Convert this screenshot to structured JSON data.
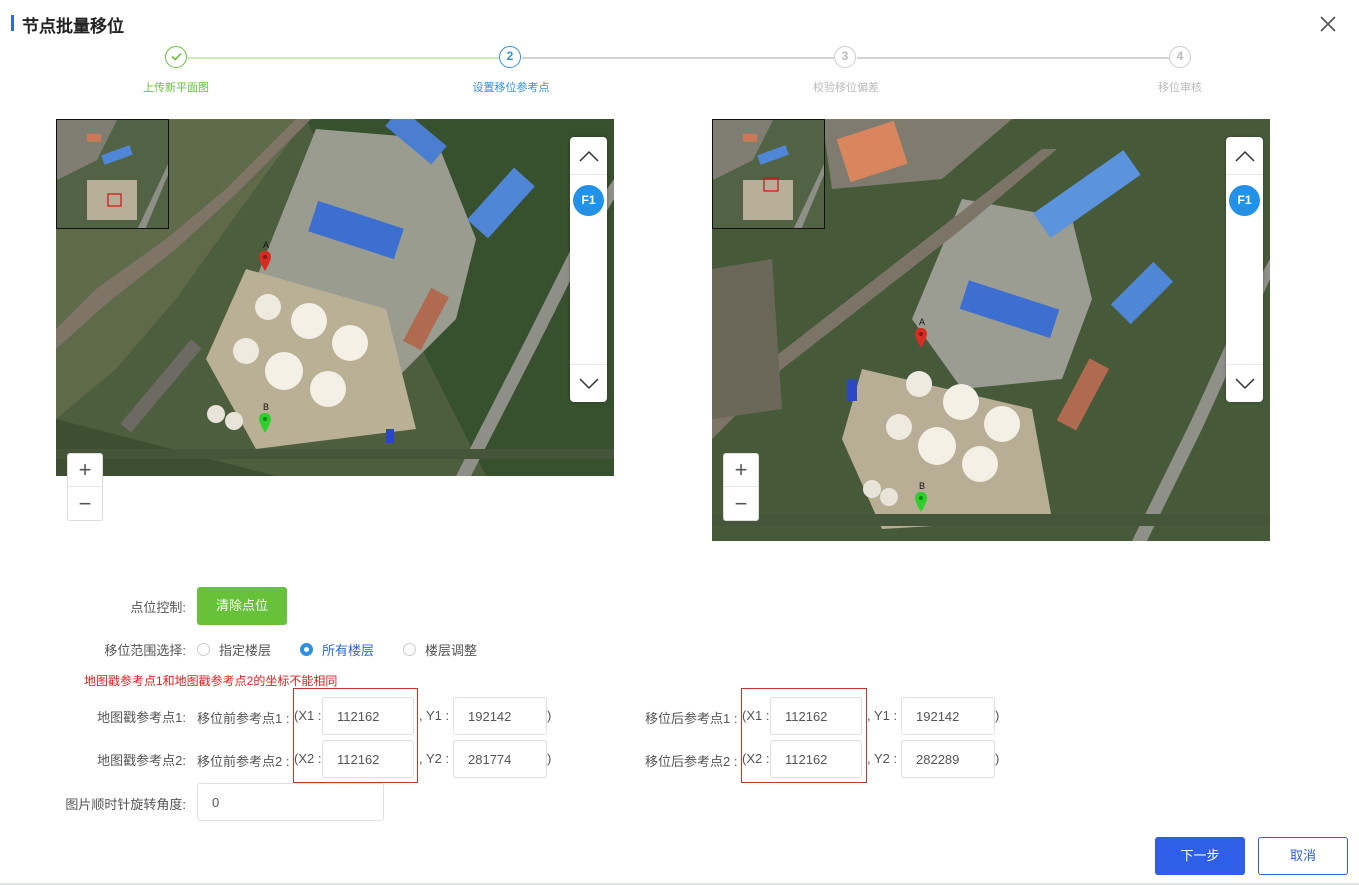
{
  "dialog": {
    "title": "节点批量移位",
    "close_icon": "close-icon"
  },
  "steps": [
    {
      "num": "1",
      "label": "上传新平面图",
      "status": "done"
    },
    {
      "num": "2",
      "label": "设置移位参考点",
      "status": "active"
    },
    {
      "num": "3",
      "label": "校验移位偏差",
      "status": "pending"
    },
    {
      "num": "4",
      "label": "移位审核",
      "status": "pending"
    }
  ],
  "maps": {
    "left": {
      "floor": "F1",
      "marker_a": "A",
      "marker_b": "B",
      "zoom_in": "+",
      "zoom_out": "−"
    },
    "right": {
      "floor": "F1",
      "marker_a": "A",
      "marker_b": "B",
      "zoom_in": "+",
      "zoom_out": "−"
    }
  },
  "form": {
    "point_control_label": "点位控制:",
    "clear_points_button": "清除点位",
    "range_label": "移位范围选择:",
    "range_options": [
      {
        "label": "指定楼层",
        "checked": false
      },
      {
        "label": "所有楼层",
        "checked": true
      },
      {
        "label": "楼层调整",
        "checked": false
      }
    ],
    "warning": "地图戳参考点1和地图戳参考点2的坐标不能相同",
    "ref1_label": "地图戳参考点1:",
    "ref2_label": "地图戳参考点2:",
    "before1_label": "移位前参考点1 :",
    "before2_label": "移位前参考点2 :",
    "after1_label": "移位后参考点1 :",
    "after2_label": "移位后参考点2 :",
    "x1_prefix": "(X1 :",
    "x2_prefix": "(X2 :",
    "y1_prefix": ", Y1 :",
    "y2_prefix": ", Y2 :",
    "close_paren": ")",
    "before": {
      "x1": "112162",
      "y1": "192142",
      "x2": "112162",
      "y2": "281774"
    },
    "after": {
      "x1": "112162",
      "y1": "192142",
      "x2": "112162",
      "y2": "282289"
    },
    "rotation_label": "图片顺时针旋转角度:",
    "rotation_value": "0"
  },
  "footer": {
    "next_button": "下一步",
    "cancel_button": "取消"
  },
  "colors": {
    "primary": "#2f5fe8",
    "success": "#67c23a",
    "error": "#e02020",
    "floor_badge": "#2391e6"
  }
}
